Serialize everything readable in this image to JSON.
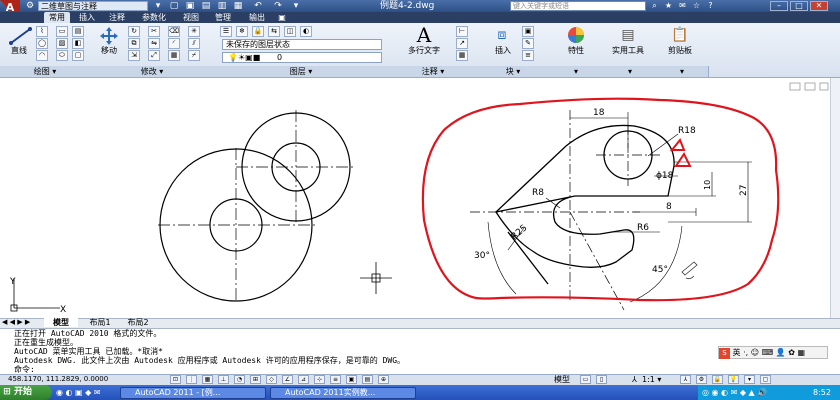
{
  "titlebar": {
    "workspace": "二维草图与注释",
    "doc_title": "例题4-2.dwg",
    "search_placeholder": "键入关键字或短语",
    "min_label": "–",
    "max_label": "□",
    "close_label": "✕"
  },
  "tabs": [
    "常用",
    "插入",
    "注释",
    "参数化",
    "视图",
    "管理",
    "输出"
  ],
  "ribbon": {
    "draw": {
      "line_label": "直线",
      "panel_title": "绘图 ▾"
    },
    "modify": {
      "move_label": "移动",
      "panel_title": "修改 ▾"
    },
    "layers": {
      "layer_state": "未保存的图层状态",
      "current_layer": "0",
      "panel_title": "图层 ▾"
    },
    "annotation": {
      "mtext_label": "多行文字",
      "panel_title": "注释 ▾"
    },
    "block": {
      "insert_label": "插入",
      "panel_title": "块 ▾"
    },
    "properties": {
      "label": "特性"
    },
    "utilities": {
      "label": "实用工具"
    },
    "clipboard": {
      "label": "剪贴板"
    }
  },
  "drawing": {
    "dims": {
      "d18_top": "18",
      "r18": "R18",
      "dia18": "ϕ18",
      "r8": "R8",
      "d10": "10",
      "d27": "27",
      "d8": "8",
      "r25": "R25",
      "r6": "R6",
      "a30": "30°",
      "a45": "45°"
    },
    "ucs_y": "Y",
    "ucs_x": "X"
  },
  "layout_tabs": [
    "模型",
    "布局1",
    "布局2"
  ],
  "command_lines": [
    "正在打开 AutoCAD 2010 格式的文件。",
    "正在重生成模型。",
    "AutoCAD 菜单实用工具 已加载。*取消*",
    "Autodesk DWG.   此文件上次由 Autodesk 应用程序或 Autodesk 许可的应用程序保存，是可靠的 DWG。"
  ],
  "command_prompt": "命令:",
  "status": {
    "coords": "458.1170, 111.2829, 0.0000",
    "model_label": "模型",
    "scale_label": "1:1 ▾"
  },
  "ime": {
    "label": "英"
  },
  "taskbar": {
    "start": "开始",
    "tasks": [
      "AutoCAD 2011 - [例...",
      "AutoCAD 2011实例教..."
    ],
    "clock": "8:52"
  },
  "colors": {
    "annotation_red": "#e0141c",
    "ribbon_bg": "#dfe8f3",
    "title_bg": "#2c4f86"
  }
}
